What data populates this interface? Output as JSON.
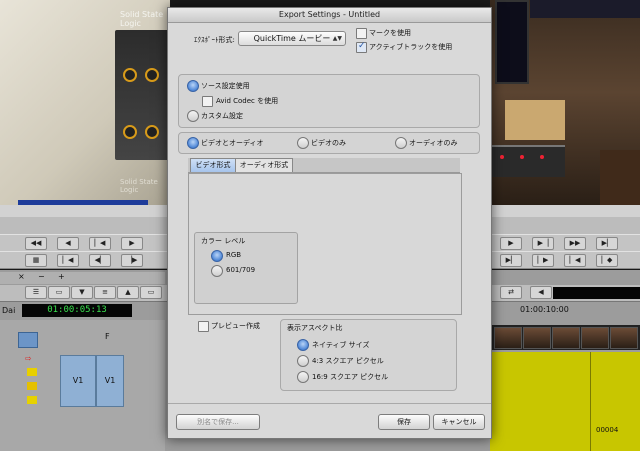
{
  "background": {
    "projector_title": "Solid State Logic",
    "projector_subtitle": "Solid State Logic",
    "timecode": "01:00:05:13",
    "timeline_ruler": "01:00:10:00",
    "clip_code": "00004",
    "track_labels": [
      "V1",
      "V1",
      "F"
    ],
    "side_label": "Dai"
  },
  "dialog": {
    "title": "Export Settings - Untitled",
    "export_format_label": "ｴｸｽﾎﾟｰﾄ形式:",
    "export_format_value": "QuickTime ムービー",
    "use_marks_label": "マークを使用",
    "use_marks_checked": false,
    "use_active_tracks_label": "アクティブトラックを使用",
    "use_active_tracks_checked": true,
    "source_settings": {
      "use_source_label": "ソース設定使用",
      "use_source_selected": true,
      "avid_codec_label": "Avid Codec を使用",
      "avid_codec_checked": false,
      "custom_label": "カスタム設定",
      "custom_selected": false
    },
    "content_options": [
      {
        "label": "ビデオとオーディオ",
        "selected": true
      },
      {
        "label": "ビデオのみ",
        "selected": false
      },
      {
        "label": "オーディオのみ",
        "selected": false
      }
    ],
    "tabs": [
      {
        "label": "ビデオ形式",
        "active": true
      },
      {
        "label": "オーディオ形式",
        "active": false
      }
    ],
    "color_level": {
      "title": "カラー レベル",
      "options": [
        {
          "label": "RGB",
          "selected": true
        },
        {
          "label": "601/709",
          "selected": false
        }
      ]
    },
    "preview_label": "プレビュー作成",
    "preview_checked": false,
    "aspect_ratio": {
      "title": "表示アスペクト比",
      "options": [
        {
          "label": "ネイティブ サイズ",
          "selected": true
        },
        {
          "label": "4:3 スクエア ピクセル",
          "selected": false
        },
        {
          "label": "16:9 スクエア ピクセル",
          "selected": false
        }
      ]
    },
    "buttons": {
      "save_as": "別名で保存...",
      "save": "保存",
      "cancel": "キャンセル"
    }
  },
  "colors": {
    "accent_blue": "#4d86d6",
    "timecode_green": "#38e04d",
    "timeline_yellow": "#c8c600"
  }
}
